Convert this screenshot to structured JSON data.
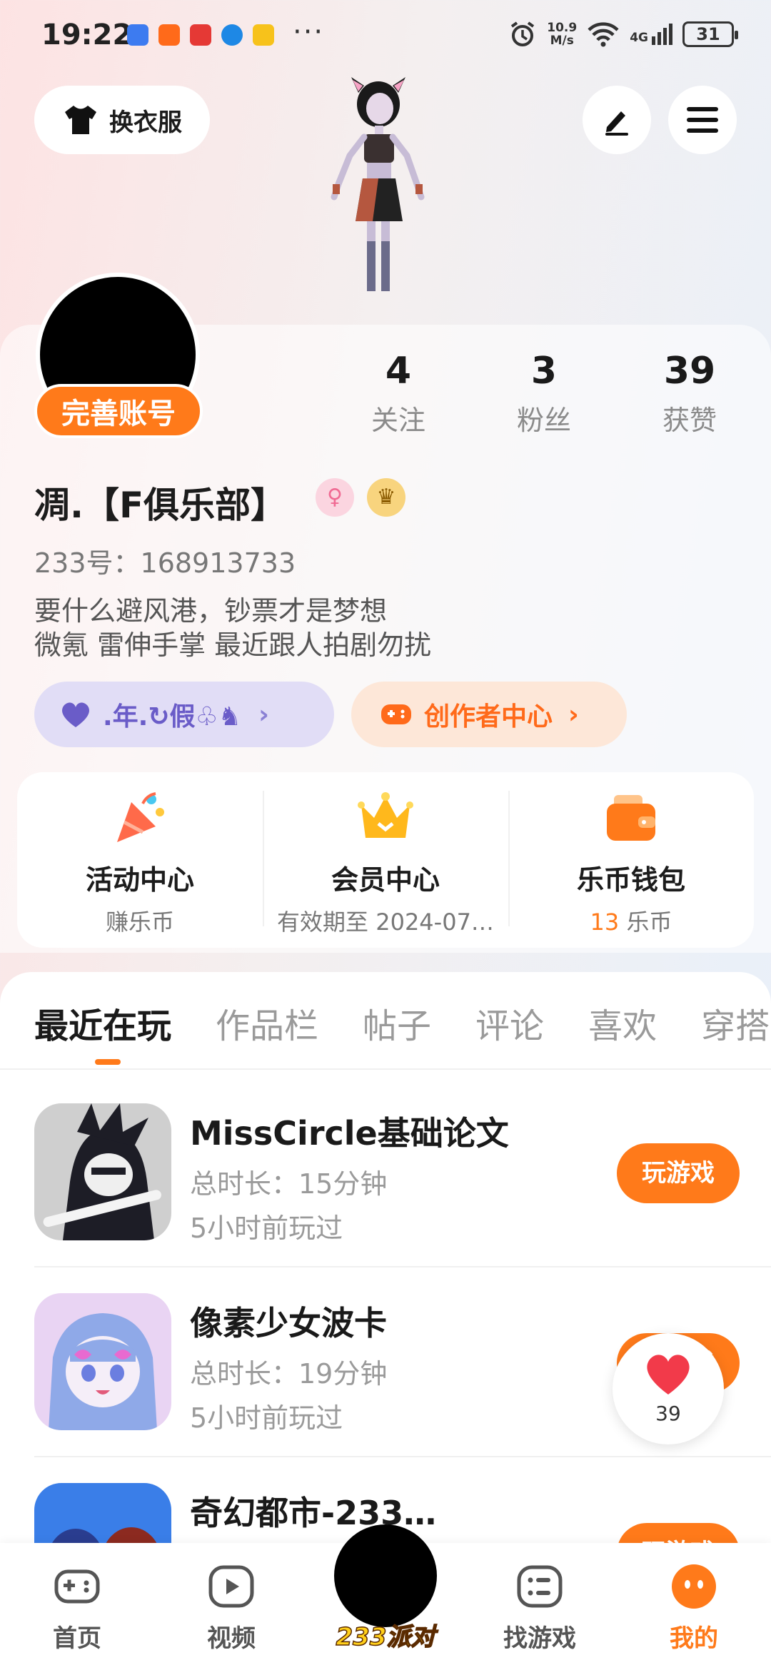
{
  "status_bar": {
    "time": "19:22",
    "more": "···",
    "net_speed_top": "10.9",
    "net_speed_bottom": "M/s",
    "signal_label": "4G",
    "battery": "31"
  },
  "top_actions": {
    "dress_up_label": "换衣服"
  },
  "profile": {
    "complete_label": "完善账号",
    "username": "凋.【F俱乐部】",
    "user_id": "233号：168913733",
    "bio_line1": "要什么避风港，钞票才是梦想",
    "bio_line2": "微氪 雷伸手掌 最近跟人拍剧勿扰",
    "gender_icon": "female-icon",
    "crown_icon": "crown-icon"
  },
  "stats": [
    {
      "value": "4",
      "label": "关注"
    },
    {
      "value": "3",
      "label": "粉丝"
    },
    {
      "value": "39",
      "label": "获赞"
    }
  ],
  "pills": {
    "family_label": ".年.↻假♧♞",
    "creator_label": "创作者中心"
  },
  "quick": [
    {
      "title": "活动中心",
      "sub": "赚乐币"
    },
    {
      "title": "会员中心",
      "sub": "有效期至 2024-07…"
    },
    {
      "title": "乐币钱包",
      "coin": "13",
      "unit": " 乐币"
    }
  ],
  "tabs": [
    "最近在玩",
    "作品栏",
    "帖子",
    "评论",
    "喜欢",
    "穿搭"
  ],
  "games": [
    {
      "title": "MissCircle基础论文",
      "duration": "总时长：15分钟",
      "last": "5小时前玩过",
      "action": "玩游戏"
    },
    {
      "title": "像素少女波卡",
      "duration": "总时长：19分钟",
      "last": "5小时前玩过",
      "action": "玩游戏"
    },
    {
      "title": "奇幻都市-233…",
      "duration": "",
      "last": "",
      "action": "玩游戏"
    }
  ],
  "like_bubble": {
    "count": "39"
  },
  "nav": [
    {
      "label": "首页",
      "icon": "gamepad-icon"
    },
    {
      "label": "视频",
      "icon": "video-icon"
    },
    {
      "label": "233派对",
      "icon": "party-icon"
    },
    {
      "label": "找游戏",
      "icon": "list-icon"
    },
    {
      "label": "我的",
      "icon": "face-icon"
    }
  ],
  "colors": {
    "accent": "#ff7a1a",
    "purple": "#6a5cc8"
  }
}
